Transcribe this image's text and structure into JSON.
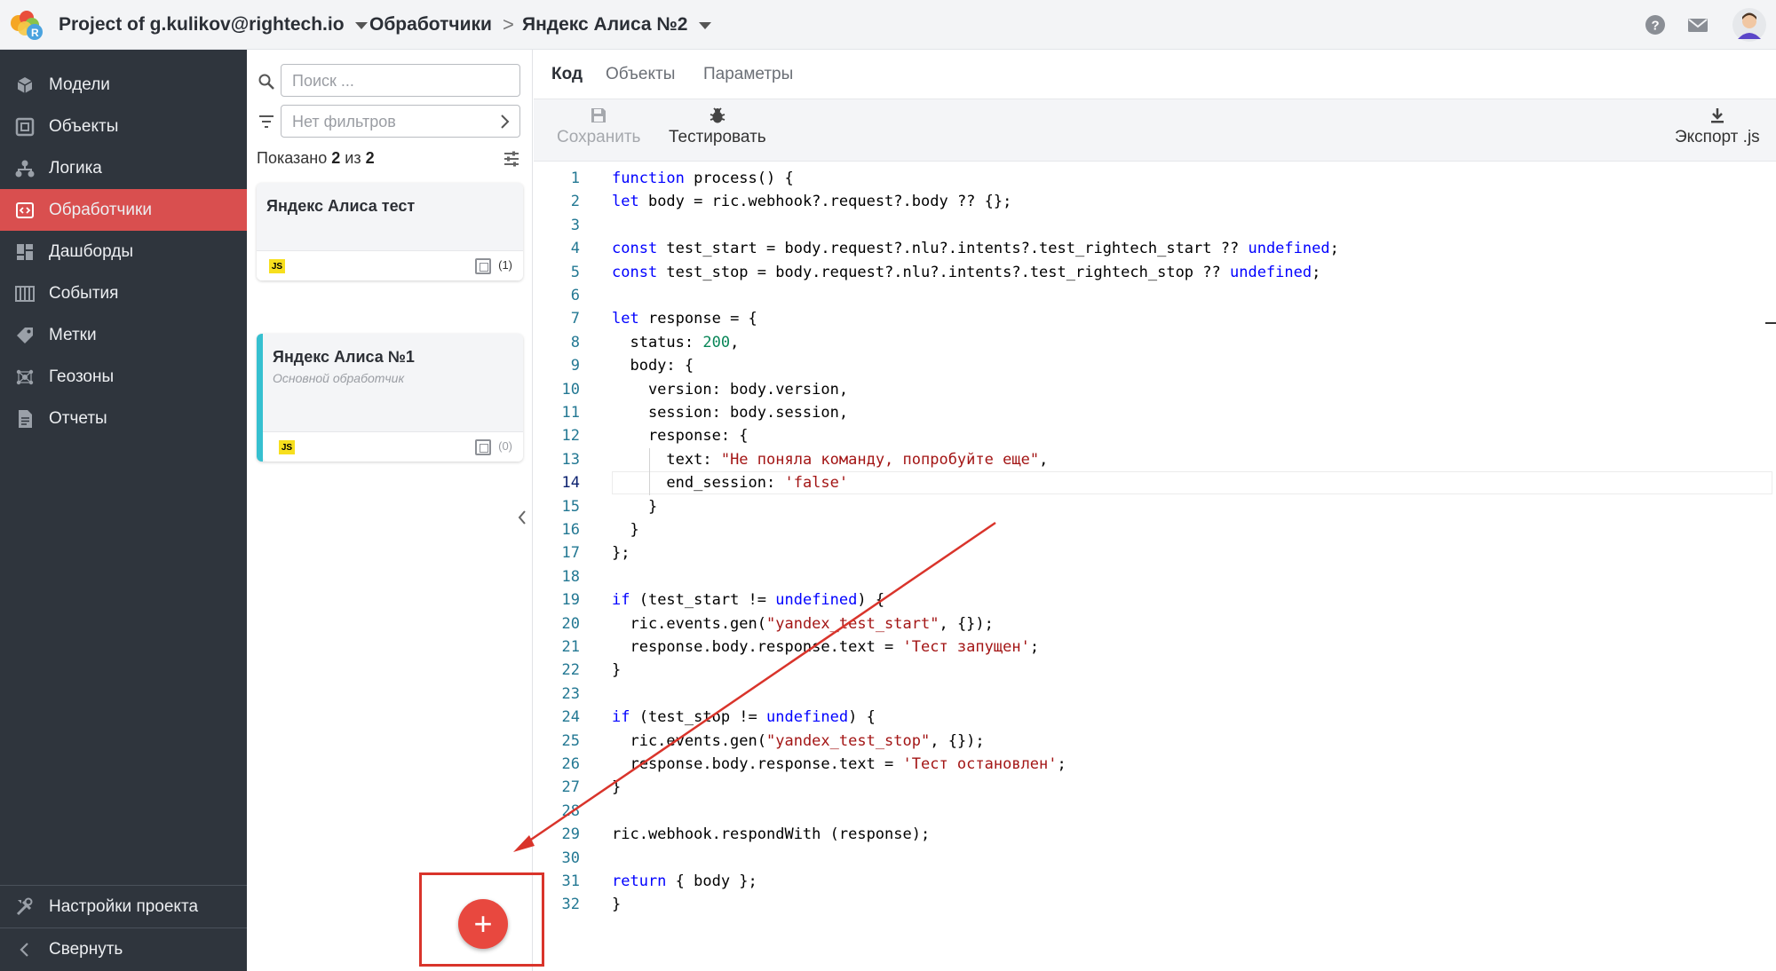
{
  "header": {
    "project": "Project of g.kulikov@rightech.io",
    "section": "Обработчики",
    "separator": ">",
    "handler": "Яндекс Алиса №2"
  },
  "sidebar": {
    "items": [
      {
        "label": "Модели",
        "icon": "cube-icon"
      },
      {
        "label": "Объекты",
        "icon": "object-icon"
      },
      {
        "label": "Логика",
        "icon": "logic-icon"
      },
      {
        "label": "Обработчики",
        "icon": "code-icon",
        "active": true
      },
      {
        "label": "Дашборды",
        "icon": "dashboard-icon"
      },
      {
        "label": "События",
        "icon": "events-icon"
      },
      {
        "label": "Метки",
        "icon": "tag-icon"
      },
      {
        "label": "Геозоны",
        "icon": "geozone-icon"
      },
      {
        "label": "Отчеты",
        "icon": "report-icon"
      }
    ],
    "settings_label": "Настройки проекта",
    "collapse_label": "Свернуть"
  },
  "list": {
    "search_placeholder": "Поиск ...",
    "filter_placeholder": "Нет фильтров",
    "shown_prefix": "Показано",
    "shown_count": "2",
    "shown_of": "из",
    "shown_total": "2",
    "cards": [
      {
        "title": "Яндекс Алиса тест",
        "subtitle": "",
        "badge": "JS",
        "objects": "(1)"
      },
      {
        "title": "Яндекс Алиса №1",
        "subtitle": "Основной обработчик",
        "badge": "JS",
        "objects": "(0)"
      }
    ]
  },
  "tabs": [
    "Код",
    "Объекты",
    "Параметры"
  ],
  "toolbar": {
    "save_label": "Сохранить",
    "test_label": "Тестировать",
    "export_label": "Экспорт .js"
  },
  "editor": {
    "current_line": 14,
    "lines": [
      "function process() {",
      "let body = ric.webhook?.request?.body ?? {};",
      "",
      "const test_start = body.request?.nlu?.intents?.test_rightech_start ?? undefined;",
      "const test_stop = body.request?.nlu?.intents?.test_rightech_stop ?? undefined;",
      "",
      "let response = {",
      "  status: 200,",
      "  body: {",
      "    version: body.version,",
      "    session: body.session,",
      "    response: {",
      "      text: \"Не поняла команду, попробуйте еще\",",
      "      end_session: 'false'",
      "    }",
      "  }",
      "};",
      "",
      "if (test_start != undefined) {",
      "  ric.events.gen(\"yandex_test_start\", {});",
      "  response.body.response.text = 'Тест запущен';",
      "}",
      "",
      "if (test_stop != undefined) {",
      "  ric.events.gen(\"yandex_test_stop\", {});",
      "  response.body.response.text = 'Тест остановлен';",
      "}",
      "",
      "ric.webhook.respondWith (response);",
      "",
      "return { body };",
      "}"
    ]
  },
  "fab": {
    "label": "+"
  },
  "colors": {
    "accent": "#d94f4f",
    "fab": "#e8483f",
    "annotation": "#d9342b"
  }
}
